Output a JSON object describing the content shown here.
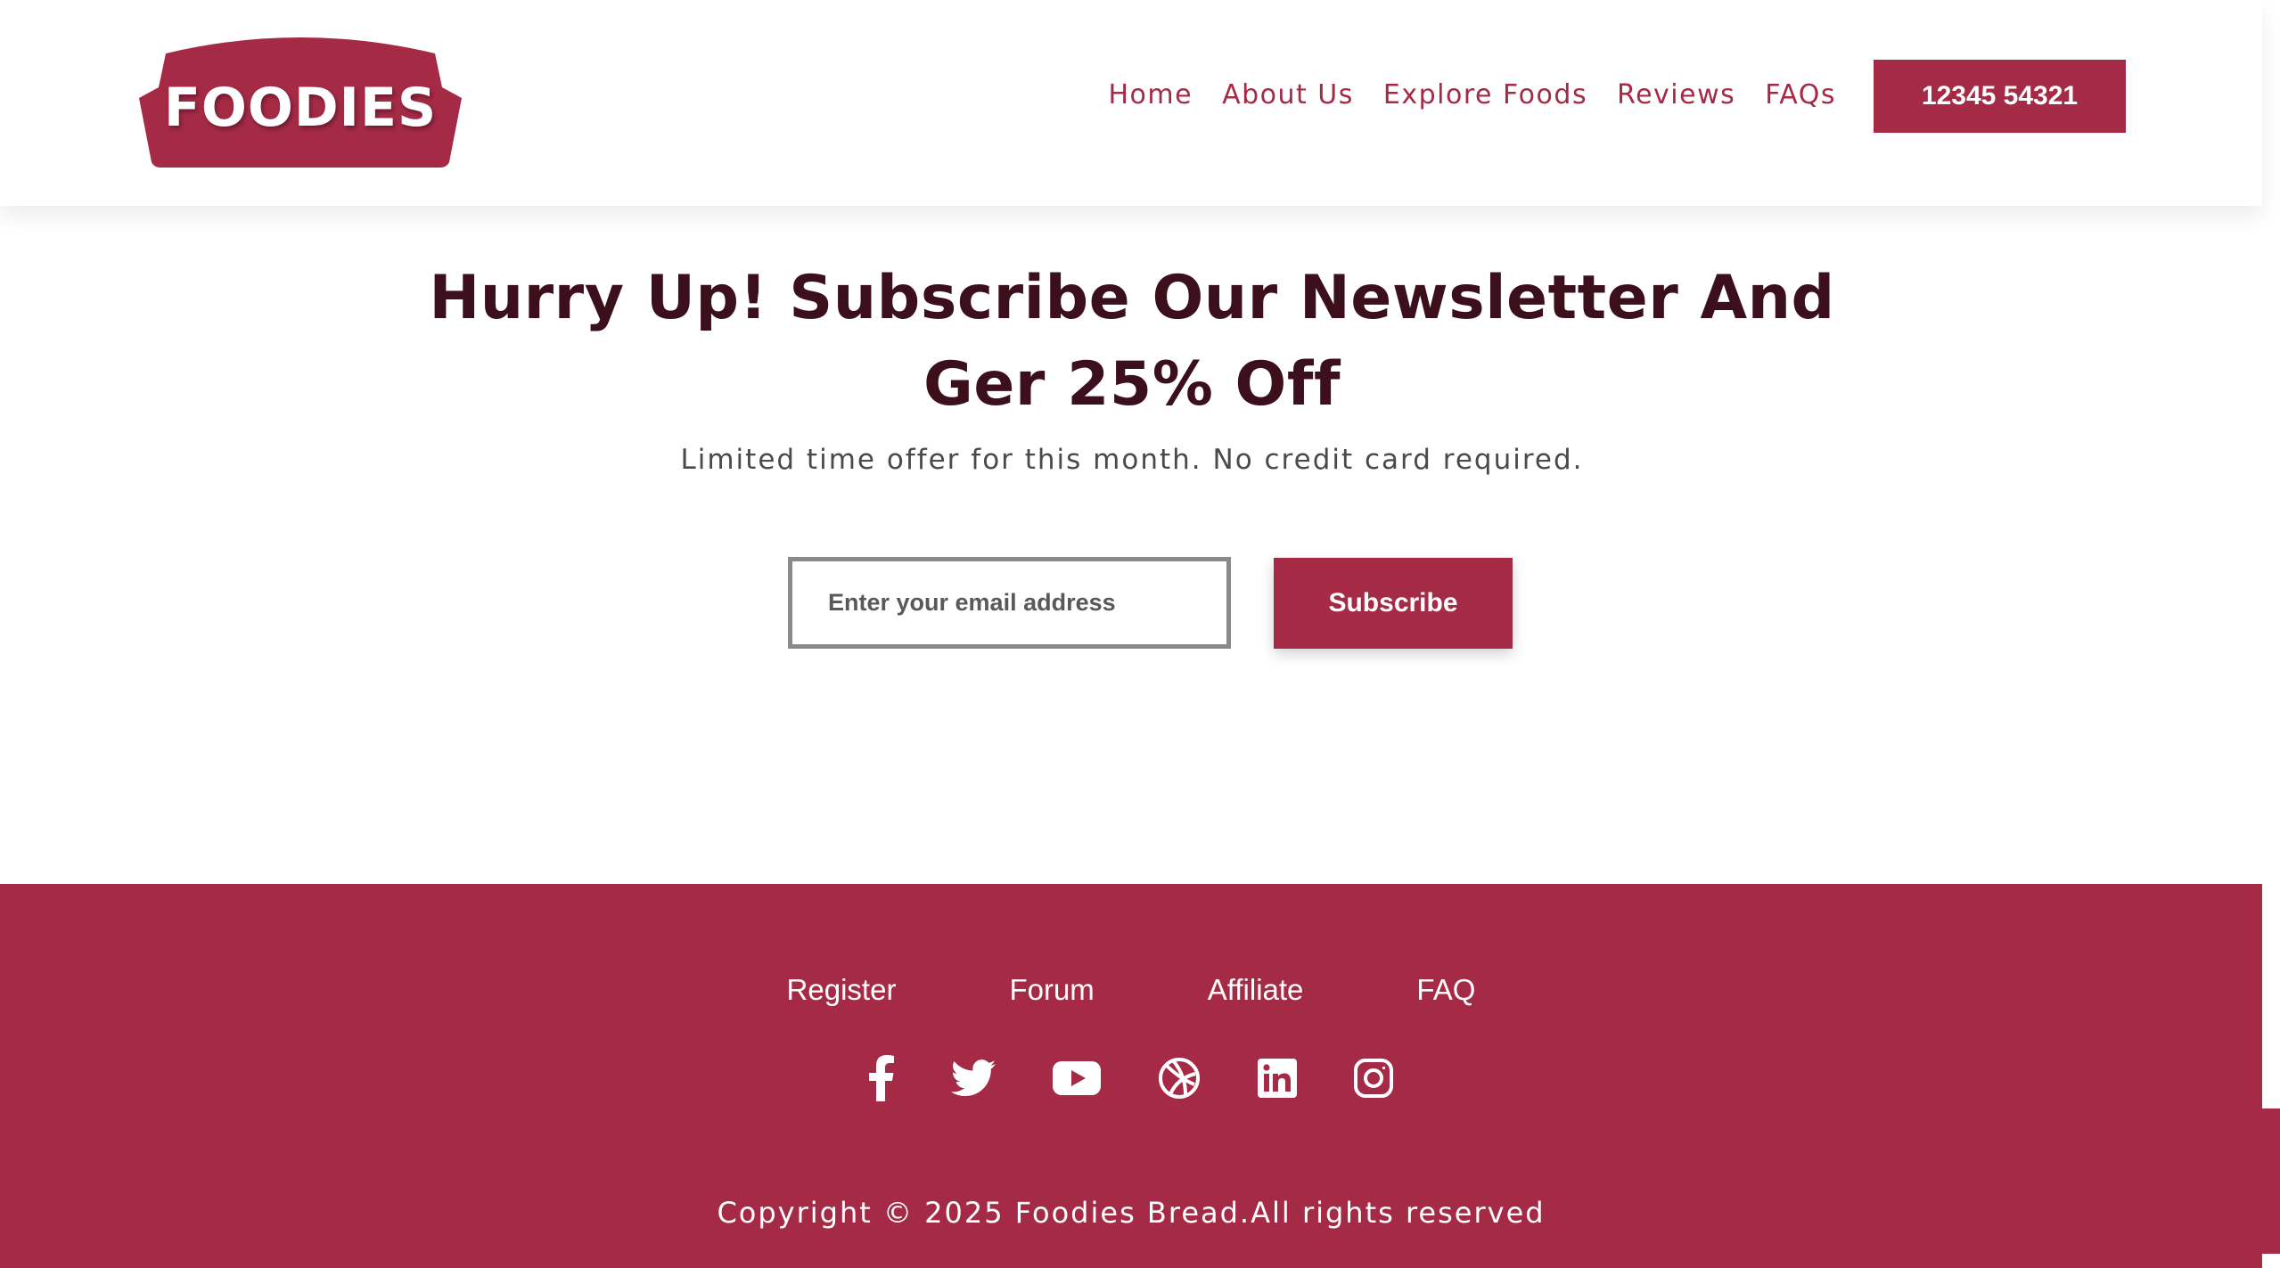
{
  "colors": {
    "brand": "#a52a46",
    "heading": "#3c0f1c",
    "text": "#4a4a4a",
    "white": "#ffffff"
  },
  "header": {
    "logo_text": "FOODIES",
    "nav": [
      {
        "label": "Home"
      },
      {
        "label": "About Us"
      },
      {
        "label": "Explore Foods"
      },
      {
        "label": "Reviews"
      },
      {
        "label": "FAQs"
      }
    ],
    "phone": "12345 54321"
  },
  "newsletter": {
    "headline_line1": "Hurry Up! Subscribe Our Newsletter And",
    "headline_line2": "Ger 25% Off",
    "subtext": "Limited time offer for this month. No credit card required.",
    "email_placeholder": "Enter your email address",
    "subscribe_label": "Subscribe"
  },
  "footer": {
    "links": [
      {
        "label": "Register"
      },
      {
        "label": "Forum"
      },
      {
        "label": "Affiliate"
      },
      {
        "label": "FAQ"
      }
    ],
    "social_icons": [
      "facebook-icon",
      "twitter-icon",
      "youtube-icon",
      "dribbble-icon",
      "linkedin-icon",
      "instagram-icon"
    ],
    "copyright": "Copyright © 2025 Foodies Bread.All rights reserved"
  }
}
